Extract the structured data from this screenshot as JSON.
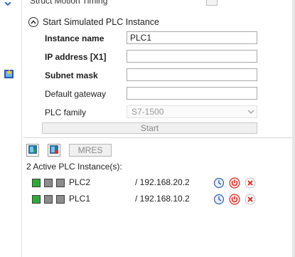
{
  "top_cut": {
    "label": "Struct Motion Timing"
  },
  "section": {
    "title": "Start Simulated PLC Instance"
  },
  "form": {
    "instance_name": {
      "label": "Instance name",
      "value": "PLC1"
    },
    "ip_address": {
      "label": "IP address [X1]",
      "value": ""
    },
    "subnet_mask": {
      "label": "Subnet mask",
      "value": ""
    },
    "default_gateway": {
      "label": "Default gateway",
      "value": ""
    },
    "plc_family": {
      "label": "PLC family",
      "value": "S7-1500"
    },
    "start_label": "Start"
  },
  "toolbar": {
    "mres_label": "MRES"
  },
  "active": {
    "count_label": "2 Active PLC Instance(s):",
    "instances": [
      {
        "name": "PLC2",
        "ip": "/ 192.168.20.2",
        "status": "running"
      },
      {
        "name": "PLC1",
        "ip": "/ 192.168.10.2",
        "status": "running"
      }
    ]
  },
  "colors": {
    "run_led": "#2eaa3a",
    "off_led": "#8c8c8c",
    "power_icon": "#d9322b",
    "delete_icon": "#d9322b",
    "settings_icon": "#2f5fb3"
  },
  "icons": [
    "app-logo-icon",
    "collapse-up-icon",
    "chevron-down-icon",
    "start-instance-icon",
    "stop-instance-icon",
    "settings-icon",
    "power-icon",
    "delete-icon"
  ]
}
